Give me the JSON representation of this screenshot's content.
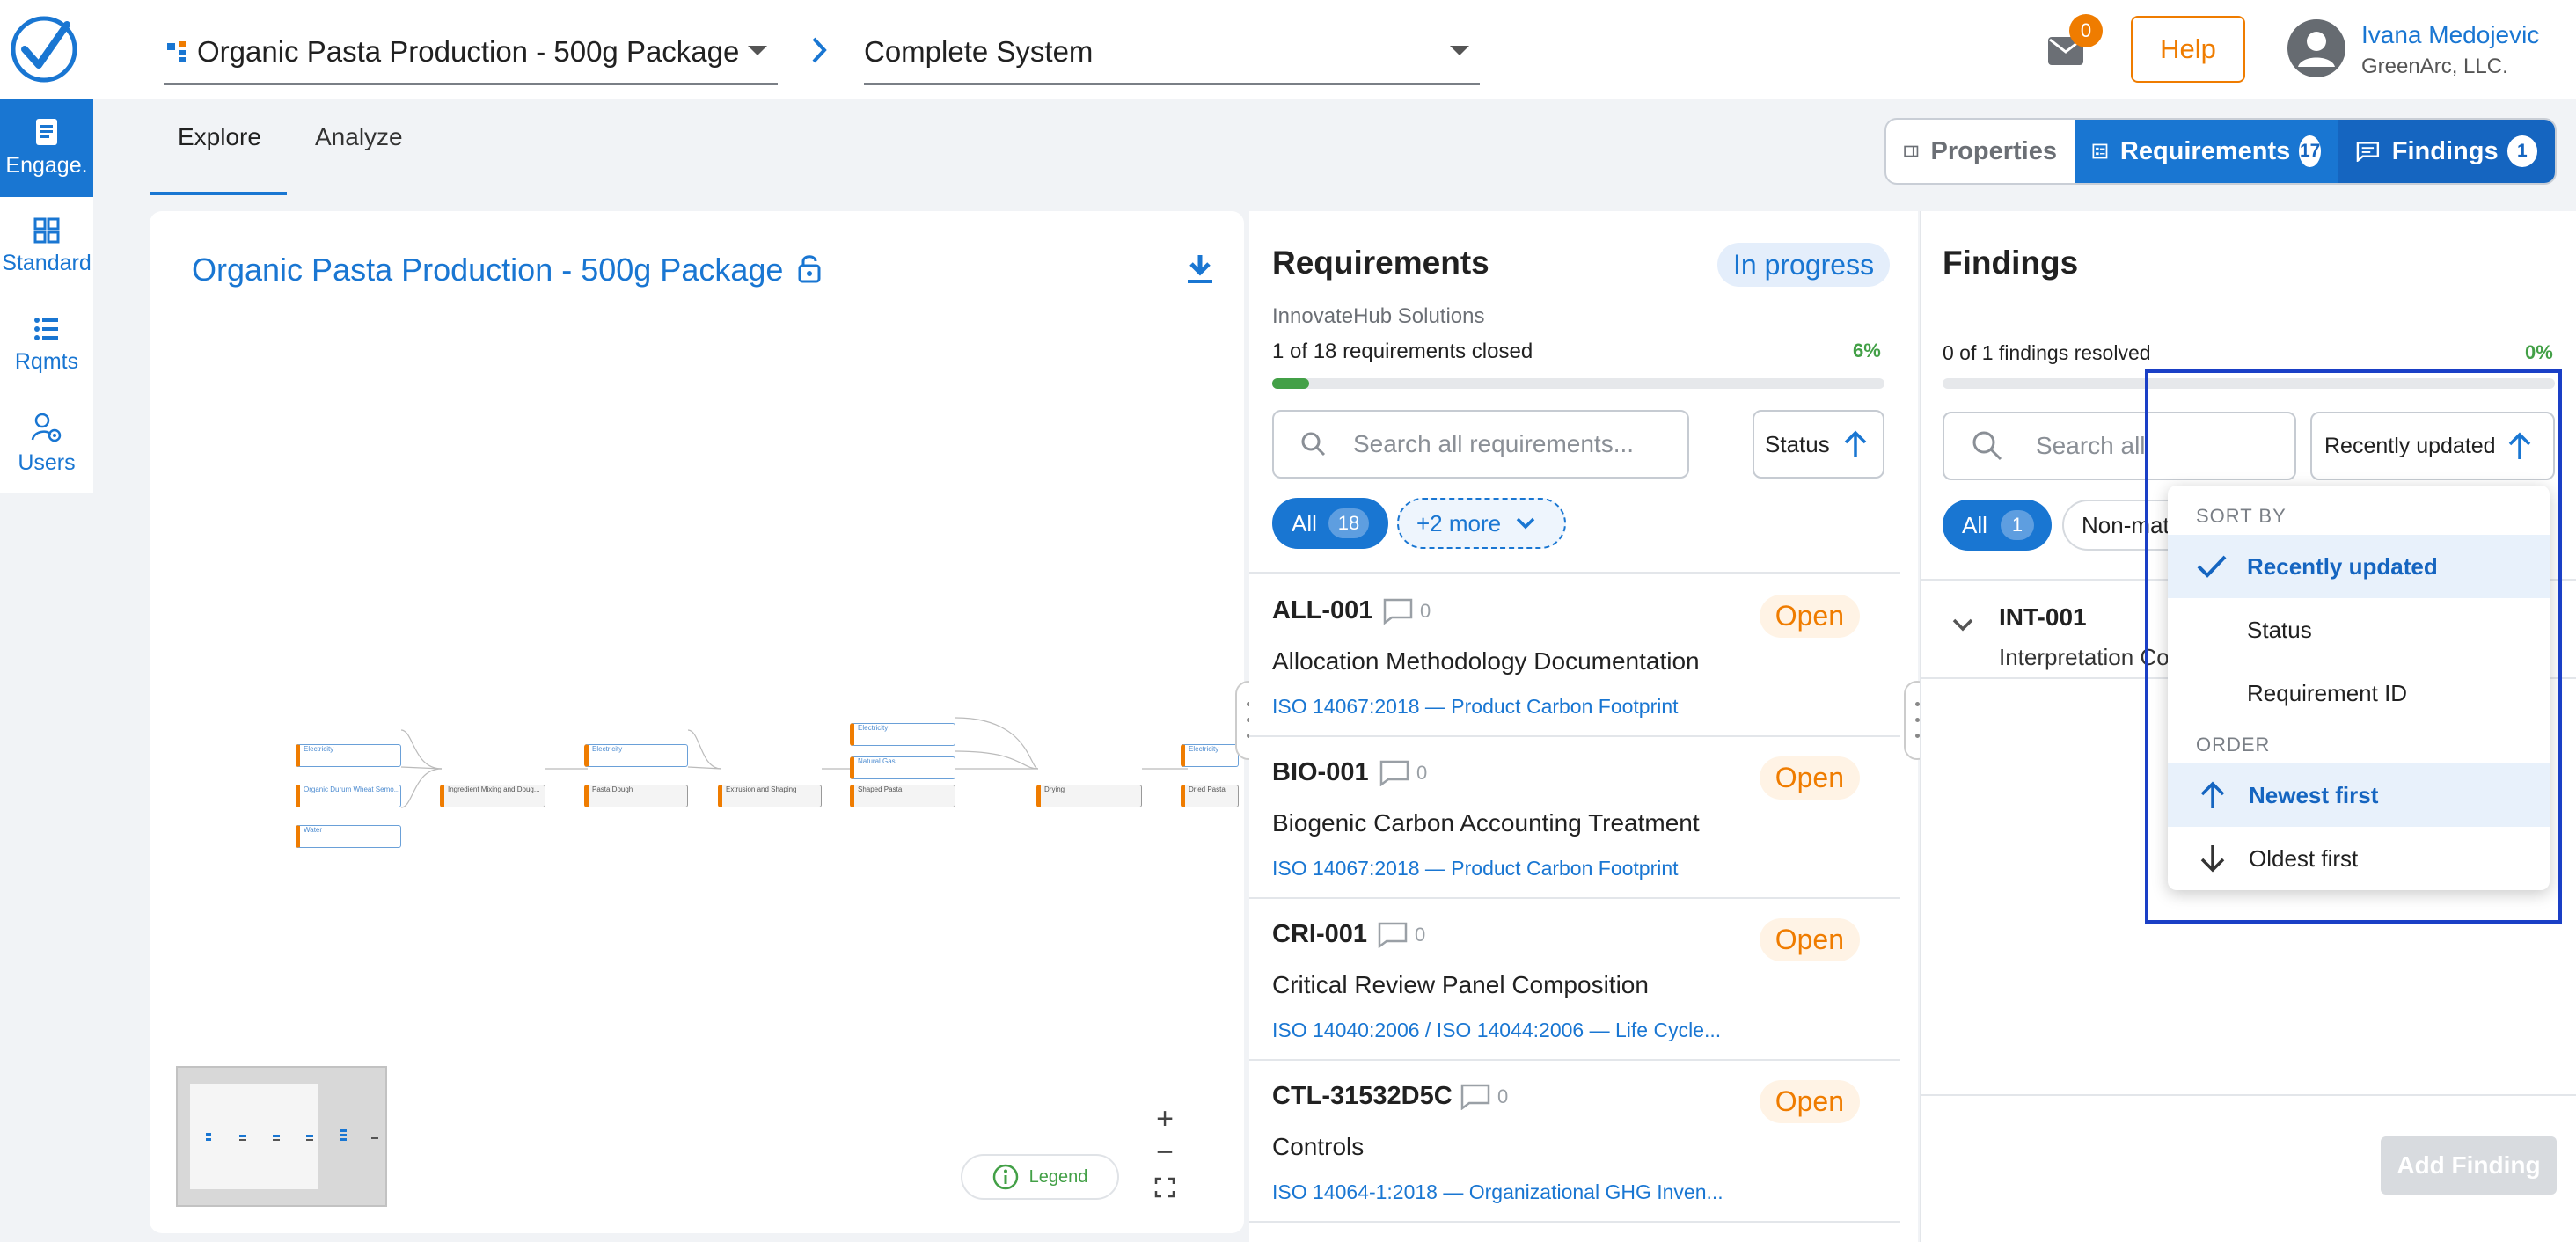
{
  "header": {
    "product_select": "Organic Pasta Production - 500g Package",
    "system_select": "Complete System",
    "mail_count": "0",
    "help_label": "Help",
    "user_name": "Ivana Medojevic",
    "user_org": "GreenArc, LLC."
  },
  "rail": [
    {
      "label": "Engage.",
      "icon": "document-icon"
    },
    {
      "label": "Standard",
      "icon": "grid-icon"
    },
    {
      "label": "Rqmts",
      "icon": "list-icon"
    },
    {
      "label": "Users",
      "icon": "users-gear-icon"
    }
  ],
  "tabs": {
    "explore": "Explore",
    "analyze": "Analyze"
  },
  "view_toggle": {
    "properties": "Properties",
    "requirements": "Requirements",
    "requirements_count": "17",
    "findings": "Findings",
    "findings_count": "1"
  },
  "explore_panel": {
    "title": "Organic Pasta Production - 500g Package",
    "legend": "Legend",
    "flow_nodes": [
      "Electricity",
      "Organic Durum Wheat Semo...",
      "Water",
      "Ingredient Mixing and Doug...",
      "Electricity",
      "Pasta Dough",
      "Extrusion and Shaping",
      "Electricity",
      "Natural Gas",
      "Shaped Pasta",
      "Drying",
      "Electricity",
      "Dried Pasta"
    ]
  },
  "requirements_panel": {
    "title": "Requirements",
    "status": "In progress",
    "org": "InnovateHub Solutions",
    "closed_text": "1 of 18 requirements closed",
    "percent": "6%",
    "progress_fraction": 0.06,
    "search_placeholder": "Search all requirements...",
    "status_sort": "Status",
    "filter_all": "All",
    "filter_all_count": "18",
    "more_filters": "+2 more",
    "items": [
      {
        "id": "ALL-001",
        "comments": "0",
        "badge": "Open",
        "title": "Allocation Methodology Documentation",
        "standard": "ISO 14067:2018 — Product Carbon Footprint"
      },
      {
        "id": "BIO-001",
        "comments": "0",
        "badge": "Open",
        "title": "Biogenic Carbon Accounting Treatment",
        "standard": "ISO 14067:2018 — Product Carbon Footprint"
      },
      {
        "id": "CRI-001",
        "comments": "0",
        "badge": "Open",
        "title": "Critical Review Panel Composition",
        "standard": "ISO 14040:2006 / ISO 14044:2006 — Life Cycle..."
      },
      {
        "id": "CTL-31532D5C",
        "comments": "0",
        "badge": "Open",
        "title": "Controls",
        "standard": "ISO 14064-1:2018 — Organizational GHG Inven..."
      }
    ]
  },
  "findings_panel": {
    "title": "Findings",
    "resolved_text": "0 of 1 findings resolved",
    "percent": "0%",
    "progress_fraction": 0.0,
    "search_placeholder": "Search all",
    "sort_label": "Recently updated",
    "filter_all": "All",
    "filter_all_count": "1",
    "filter_nonmatch": "Non-mat",
    "item_id": "INT-001",
    "item_title": "Interpretation Co",
    "add_finding": "Add Finding"
  },
  "sort_menu": {
    "sort_by_heading": "SORT BY",
    "sort_options": [
      "Recently updated",
      "Status",
      "Requirement ID"
    ],
    "selected_sort": "Recently updated",
    "order_heading": "ORDER",
    "order_options": [
      "Newest first",
      "Oldest first"
    ],
    "selected_order": "Newest first"
  },
  "colors": {
    "primary": "#1976d2",
    "accent_orange": "#ef7c00",
    "success_green": "#43a047",
    "highlight_outline": "#1a3fc6"
  }
}
